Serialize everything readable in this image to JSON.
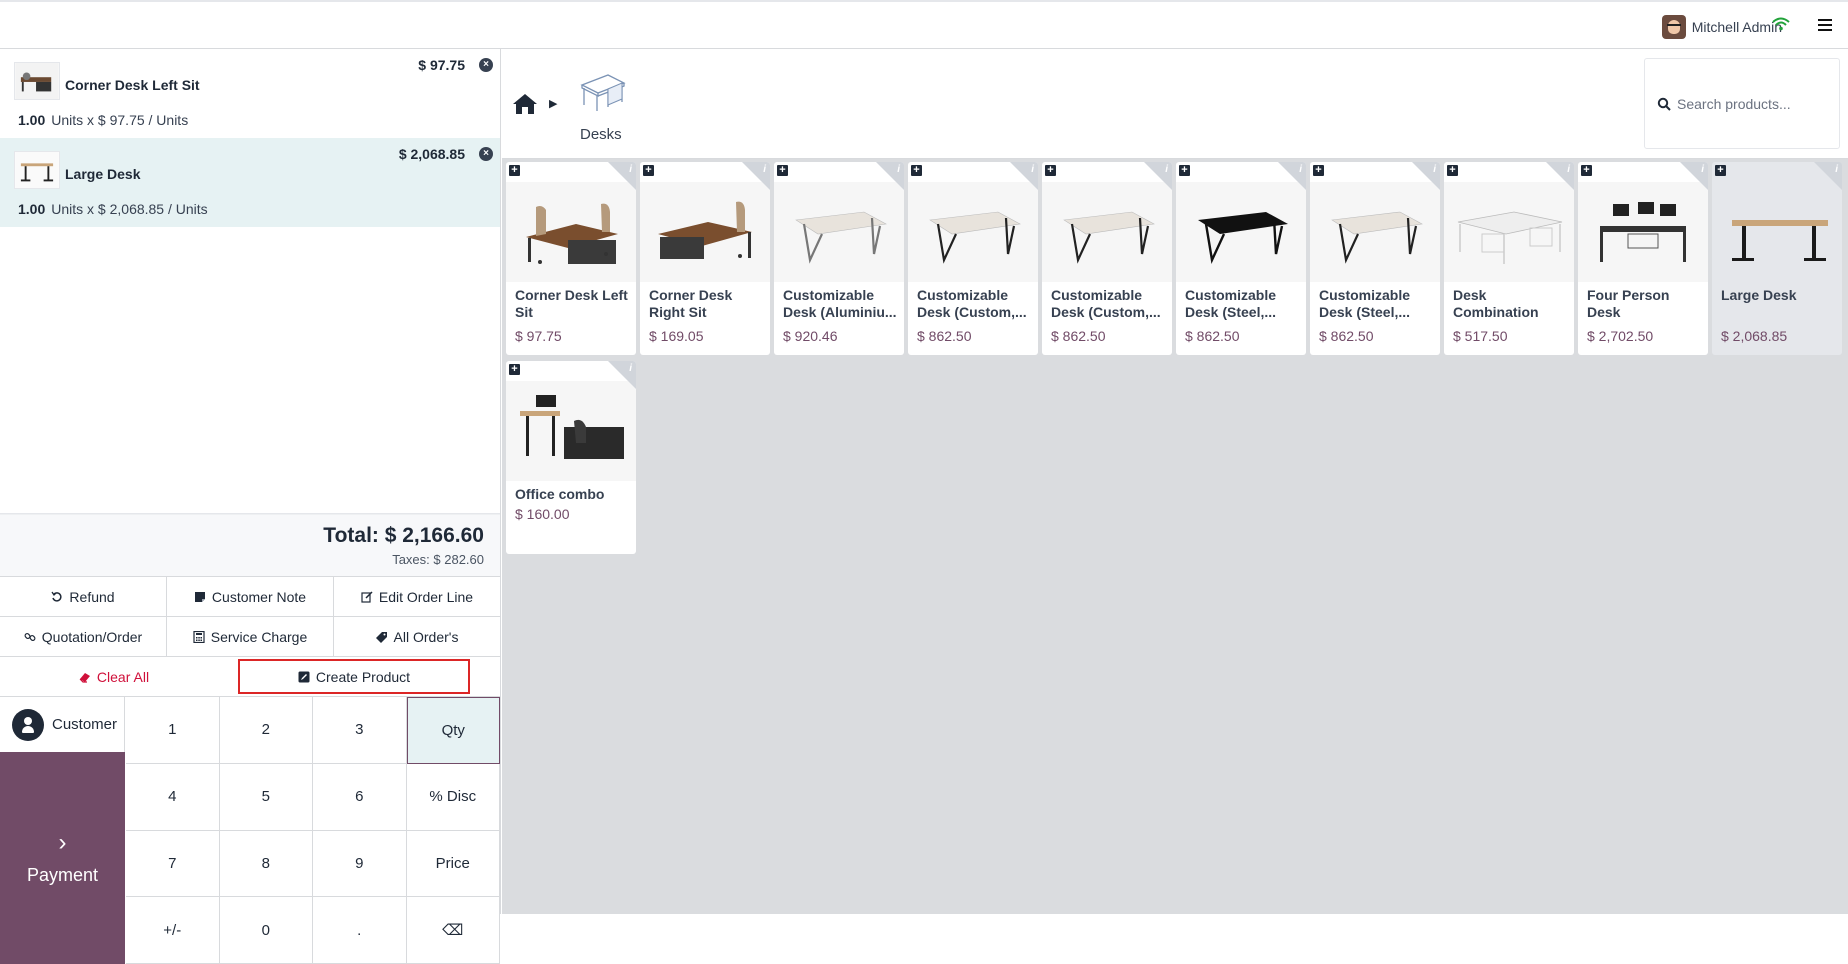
{
  "header": {
    "user_name": "Mitchell Admin",
    "wifi_icon": "wifi-icon",
    "menu_icon": "hamburger-icon"
  },
  "order": {
    "lines": [
      {
        "name": "Corner Desk Left Sit",
        "price": "$ 97.75",
        "qty": "1.00",
        "unit_text": "Units x $ 97.75 / Units",
        "selected": false
      },
      {
        "name": "Large Desk",
        "price": "$ 2,068.85",
        "qty": "1.00",
        "unit_text": "Units x $ 2,068.85 / Units",
        "selected": true
      }
    ],
    "total": "Total: $ 2,166.60",
    "taxes": "Taxes: $ 282.60"
  },
  "actions": {
    "refund": "Refund",
    "customer_note": "Customer Note",
    "edit_order_line": "Edit Order Line",
    "quotation_order": "Quotation/Order",
    "service_charge": "Service Charge",
    "all_orders": "All Order's",
    "clear_all": "Clear All",
    "create_product": "Create Product"
  },
  "numpad": {
    "customer": "Customer",
    "payment": "Payment",
    "keys": [
      "1",
      "2",
      "3",
      "Qty",
      "4",
      "5",
      "6",
      "% Disc",
      "7",
      "8",
      "9",
      "Price",
      "+/-",
      "0",
      ".",
      "⌫"
    ],
    "active_mode": "Qty"
  },
  "breadcrumb": {
    "category": "Desks"
  },
  "search": {
    "placeholder": "Search products..."
  },
  "products": [
    {
      "name": "Corner Desk Left Sit",
      "price": "$ 97.75"
    },
    {
      "name": "Corner Desk Right Sit",
      "price": "$ 169.05"
    },
    {
      "name": "Customizable Desk (Aluminiu...",
      "price": "$ 920.46"
    },
    {
      "name": "Customizable Desk (Custom,...",
      "price": "$ 862.50"
    },
    {
      "name": "Customizable Desk (Custom,...",
      "price": "$ 862.50"
    },
    {
      "name": "Customizable Desk (Steel,...",
      "price": "$ 862.50"
    },
    {
      "name": "Customizable Desk (Steel,...",
      "price": "$ 862.50"
    },
    {
      "name": "Desk Combination",
      "price": "$ 517.50"
    },
    {
      "name": "Four Person Desk",
      "price": "$ 2,702.50"
    },
    {
      "name": "Large Desk",
      "price": "$ 2,068.85"
    },
    {
      "name": "Office combo",
      "price": "$ 160.00"
    }
  ],
  "colors": {
    "brand": "#714b67",
    "selected_line": "#e6f2f3",
    "danger": "#d0103a"
  }
}
